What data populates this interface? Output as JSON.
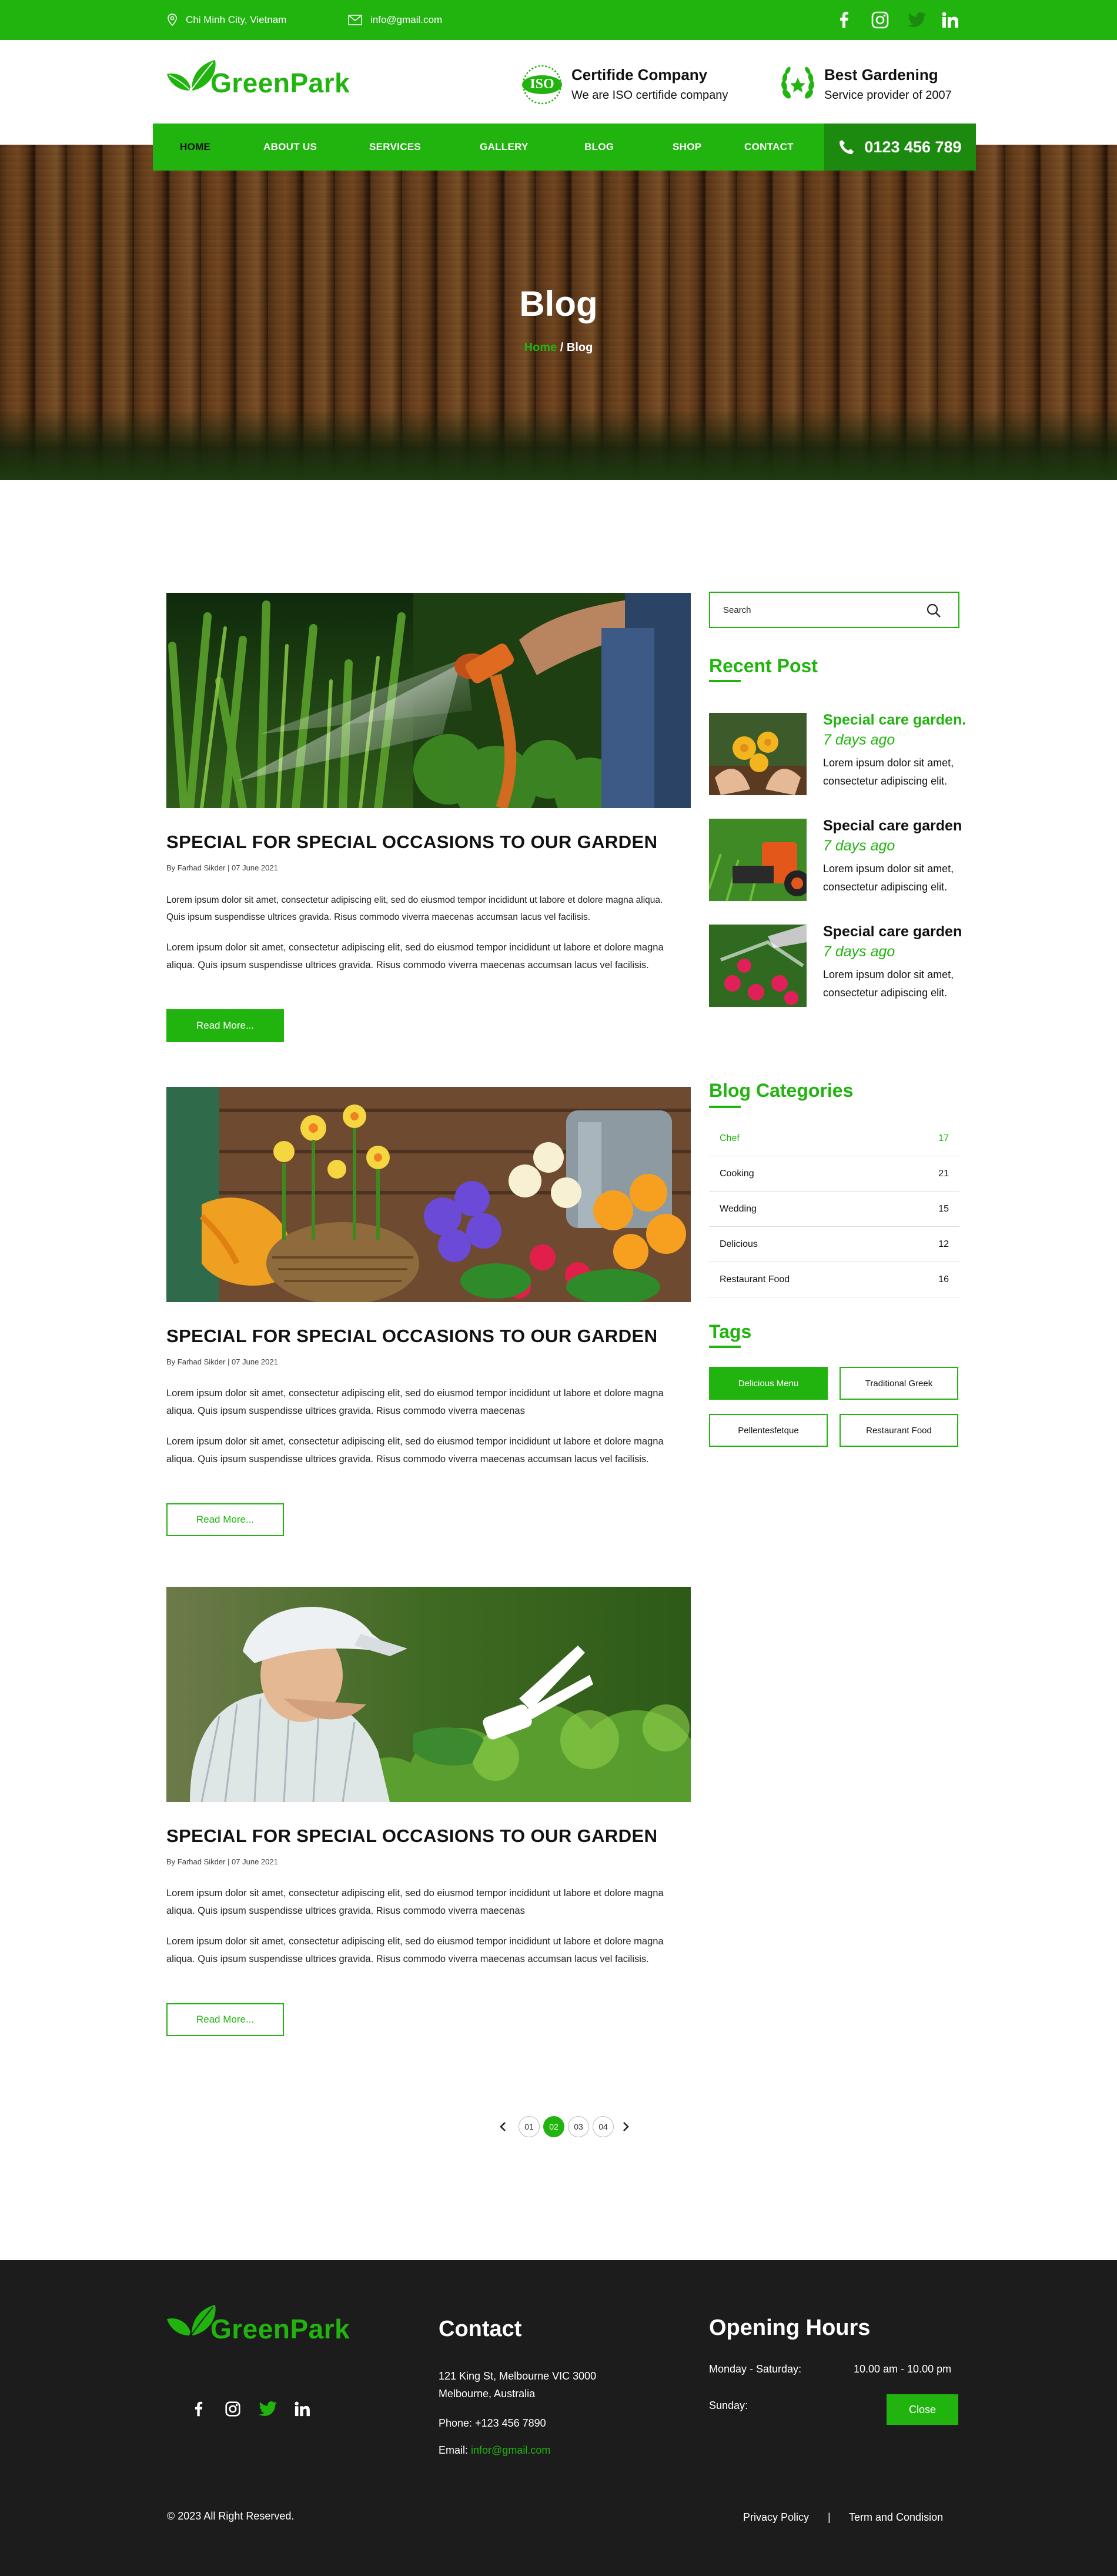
{
  "topbar": {
    "location": "Chi Minh City, Vietnam",
    "email": "info@gmail.com",
    "social": [
      "facebook-icon",
      "instagram-icon",
      "twitter-icon",
      "linkedin-icon"
    ]
  },
  "brand": {
    "logo_text": "GreenPark",
    "primary_color": "#21b40f",
    "dark_color": "#1c1c1c"
  },
  "header": {
    "cert_badge": "ISO",
    "cert_title": "Certifide Company",
    "cert_sub": "We are ISO certifide company",
    "best_title": "Best Gardening",
    "best_sub": "Service provider of 2007"
  },
  "nav": {
    "items": [
      "HOME",
      "ABOUT US",
      "SERVICES",
      "GALLERY",
      "BLOG",
      "SHOP",
      "CONTACT"
    ],
    "active": "HOME",
    "phone": "0123 456 789"
  },
  "hero": {
    "title": "Blog",
    "crumb_home": "Home",
    "crumb_sep": " / ",
    "crumb_current": "Blog"
  },
  "posts": [
    {
      "title": "SPECIAL  FOR SPECIAL OCCASIONS TO OUR GARDEN",
      "meta": "By Farhad Sikder   |   07 June  2021",
      "para1": "Lorem ipsum dolor sit amet, consectetur adipiscing elit, sed do eiusmod tempor incididunt ut labore et dolore magna aliqua. Quis ipsum suspendisse ultrices gravida. Risus commodo viverra maecenas accumsan lacus vel facilisis.",
      "para2": "Lorem ipsum dolor sit amet, consectetur adipiscing elit, sed do eiusmod tempor incididunt ut labore et dolore magna aliqua. Quis ipsum suspendisse ultrices gravida. Risus commodo viverra maecenas accumsan lacus vel facilisis.",
      "button": "Read More..."
    },
    {
      "title": "SPECIAL  FOR SPECIAL OCCASIONS TO OUR GARDEN",
      "meta": "By Farhad Sikder   |   07 June  2021",
      "para1": "Lorem ipsum dolor sit amet, consectetur adipiscing elit, sed do eiusmod tempor incididunt ut labore et dolore magna aliqua. Quis ipsum suspendisse ultrices gravida. Risus commodo viverra maecenas",
      "para2": "Lorem ipsum dolor sit amet, consectetur adipiscing elit, sed do eiusmod tempor incididunt ut labore et dolore magna aliqua. Quis ipsum suspendisse ultrices gravida. Risus commodo viverra maecenas accumsan lacus vel facilisis.",
      "button": "Read More..."
    },
    {
      "title": "SPECIAL  FOR SPECIAL OCCASIONS TO OUR GARDEN",
      "meta": "By Farhad Sikder   |   07 June  2021",
      "para1": "Lorem ipsum dolor sit amet, consectetur adipiscing elit, sed do eiusmod tempor incididunt ut labore et dolore magna aliqua. Quis ipsum suspendisse ultrices gravida. Risus commodo viverra maecenas",
      "para2": "Lorem ipsum dolor sit amet, consectetur adipiscing elit, sed do eiusmod tempor incididunt ut labore et dolore magna aliqua. Quis ipsum suspendisse ultrices gravida. Risus commodo viverra maecenas accumsan lacus vel facilisis.",
      "button": "Read More..."
    }
  ],
  "sidebar": {
    "search_placeholder": "Search",
    "recent_heading": "Recent  Post",
    "recent": [
      {
        "title": "Special care garden.",
        "date": "7 days ago",
        "text": "Lorem ipsum dolor sit amet, consectetur adipiscing elit."
      },
      {
        "title": "Special care garden",
        "date": "7 days ago",
        "text": "Lorem ipsum dolor sit amet, consectetur adipiscing elit."
      },
      {
        "title": "Special care garden",
        "date": "7 days ago",
        "text": "Lorem ipsum dolor sit amet, consectetur adipiscing elit."
      }
    ],
    "categories_heading": "Blog Categories",
    "categories": [
      {
        "name": "Chef",
        "count": "17"
      },
      {
        "name": "Cooking",
        "count": "21"
      },
      {
        "name": "Wedding",
        "count": "15"
      },
      {
        "name": "Delicious",
        "count": "12"
      },
      {
        "name": "Restaurant Food",
        "count": "16"
      }
    ],
    "tags_heading": "Tags",
    "tags": [
      "Delicious Menu",
      "Traditional Greek",
      "Pellentesfetque",
      "Restaurant Food"
    ]
  },
  "pagination": {
    "pages": [
      "01",
      "02",
      "03",
      "04"
    ],
    "active": "02"
  },
  "footer": {
    "logo_text": "GreenPark",
    "contact_heading": "Contact",
    "address_line1": "121 King St, Melbourne VIC 3000",
    "address_line2": "Melbourne, Australia",
    "phone": "Phone: +123 456 7890",
    "email_label": "Email: ",
    "email": "infor@gmail.com",
    "hours_heading": "Opening Hours",
    "weekday_label": "Monday - Saturday:",
    "weekday_hours": "10.00 am - 10.00 pm",
    "sunday_label": "Sunday:",
    "sunday_status": "Close",
    "copyright": "© 2023 All Right Reserved.",
    "privacy": "Privacy Policy",
    "terms": "Term and Condision",
    "separator": "|"
  }
}
